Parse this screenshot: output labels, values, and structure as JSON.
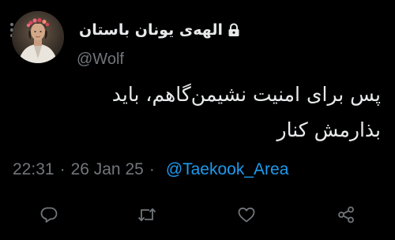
{
  "user": {
    "display_name": "الهه‌ی یونان باستان",
    "handle": "@Wolf",
    "protected_icon": "lock-icon",
    "avatar_icon": "profile-photo"
  },
  "tweet": {
    "text_lines": [
      "پس برای امنیت نشیمن‌گاهم، باید",
      "بذارمش کنار"
    ],
    "time": "22:31",
    "date": "26 Jan 25",
    "separator": "·",
    "via_mention": "@Taekook_Area"
  },
  "actions": [
    {
      "name": "reply",
      "icon": "reply-icon"
    },
    {
      "name": "retweet",
      "icon": "retweet-icon"
    },
    {
      "name": "like",
      "icon": "heart-icon"
    },
    {
      "name": "share",
      "icon": "share-icon"
    }
  ],
  "colors": {
    "background": "#000000",
    "text_primary": "#e7e9ea",
    "text_secondary": "#71767b",
    "accent": "#1d9bf0"
  }
}
